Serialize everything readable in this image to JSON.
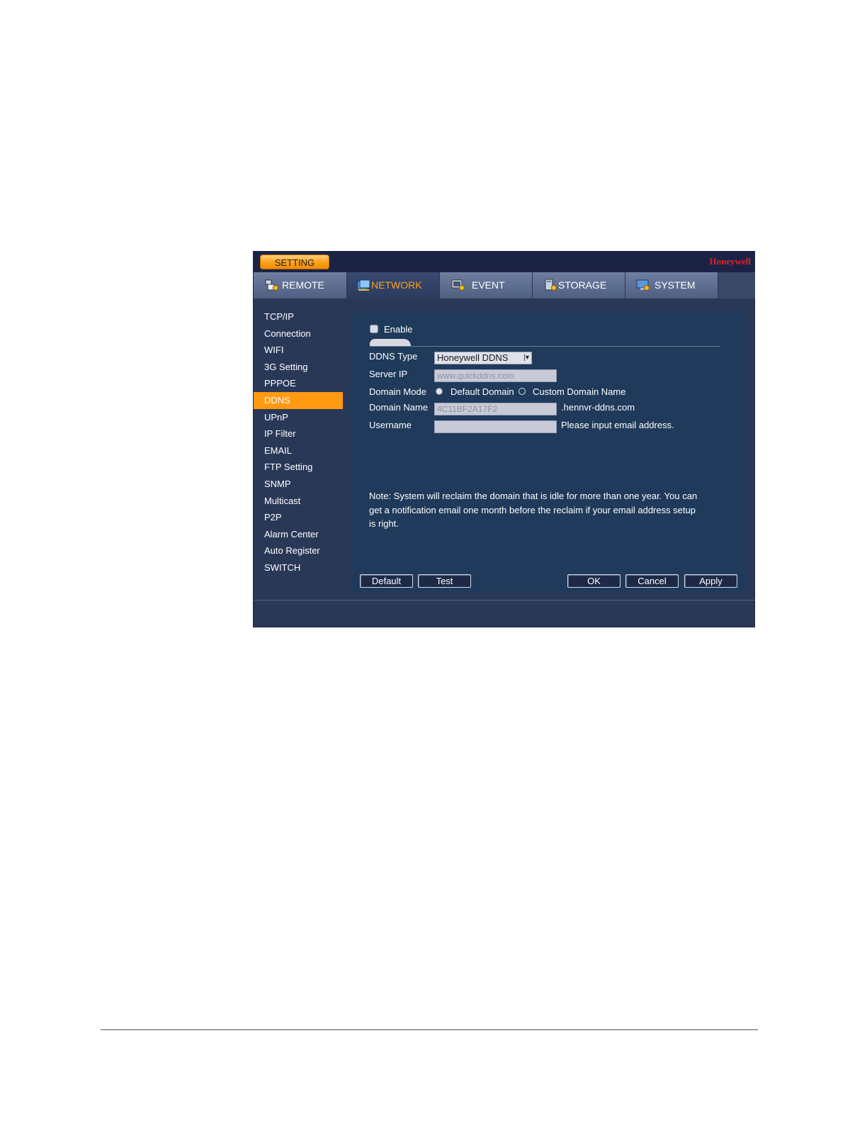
{
  "window": {
    "setting_label": "SETTING",
    "brand": "Honeywell"
  },
  "tabs": [
    {
      "label": "REMOTE",
      "icon": "remote-icon",
      "active": false
    },
    {
      "label": "NETWORK",
      "icon": "network-icon",
      "active": true
    },
    {
      "label": "EVENT",
      "icon": "event-icon",
      "active": false
    },
    {
      "label": "STORAGE",
      "icon": "storage-icon",
      "active": false
    },
    {
      "label": "SYSTEM",
      "icon": "system-icon",
      "active": false
    }
  ],
  "sidebar": {
    "items": [
      "TCP/IP",
      "Connection",
      "WIFI",
      "3G Setting",
      "PPPOE",
      "DDNS",
      "UPnP",
      "IP Filter",
      "EMAIL",
      "FTP Setting",
      "SNMP",
      "Multicast",
      "P2P",
      "Alarm Center",
      "Auto Register",
      "SWITCH"
    ],
    "active": "DDNS"
  },
  "form": {
    "enable_label": "Enable",
    "enable_checked": false,
    "ddns_type_label": "DDNS Type",
    "ddns_type_value": "Honeywell DDNS",
    "server_ip_label": "Server IP",
    "server_ip_value": "www.quickddns.com",
    "domain_mode_label": "Domain Mode",
    "domain_mode_default": "Default Domain",
    "domain_mode_custom": "Custom Domain Name",
    "domain_mode_selected": "Default Domain",
    "domain_name_label": "Domain Name",
    "domain_name_value": "4C11BF2A17F2",
    "domain_suffix": ".hennvr-ddns.com",
    "username_label": "Username",
    "username_value": "",
    "username_hint": "Please input email address.",
    "note_line1": "Note: System will reclaim the domain that is idle for more than one year. You can",
    "note_line2": "get a notification email one month before the reclaim if your email address setup",
    "note_line3": "is right."
  },
  "buttons": {
    "default": "Default",
    "test": "Test",
    "ok": "OK",
    "cancel": "Cancel",
    "apply": "Apply"
  },
  "colors": {
    "accent": "#ff9a12",
    "window_bg": "#2a3858",
    "panel_bg": "#1f3a5a",
    "brand": "#e0202a"
  }
}
